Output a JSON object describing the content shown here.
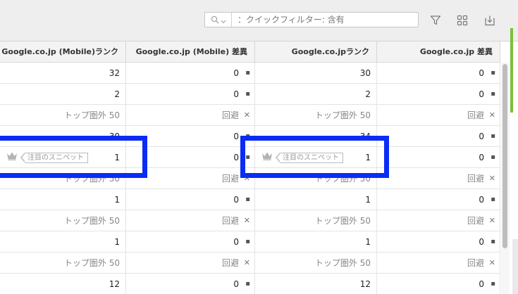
{
  "toolbar": {
    "search_placeholder": "：クイックフィルター: 含有",
    "icons": [
      "search-icon",
      "chevron-down-icon",
      "filter-icon",
      "grid-icon",
      "export-icon"
    ]
  },
  "columns": [
    "Google.co.jp (Mobile)ランク",
    "Google.co.jp (Mobile) 差異",
    "Google.co.jpランク",
    "Google.co.jp 差異"
  ],
  "snippet_label": "注目のスニペット",
  "rows": [
    {
      "r1": "32",
      "d1": "0",
      "m1": "▪",
      "r2": "30",
      "d2": "0",
      "m2": "▪",
      "muted": false,
      "snippet": false
    },
    {
      "r1": "2",
      "d1": "0",
      "m1": "▪",
      "r2": "2",
      "d2": "0",
      "m2": "▪",
      "muted": false,
      "snippet": false
    },
    {
      "r1": "トップ圏外 50",
      "d1": "回避",
      "m1": "✕",
      "r2": "トップ圏外 50",
      "d2": "回避",
      "m2": "✕",
      "muted": true,
      "snippet": false
    },
    {
      "r1": "30",
      "d1": "0",
      "m1": "▪",
      "r2": "34",
      "d2": "0",
      "m2": "▪",
      "muted": false,
      "snippet": false
    },
    {
      "r1": "1",
      "d1": "0",
      "m1": "▪",
      "r2": "1",
      "d2": "0",
      "m2": "▪",
      "muted": false,
      "snippet": true
    },
    {
      "r1": "トップ圏外 50",
      "d1": "回避",
      "m1": "✕",
      "r2": "トップ圏外 50",
      "d2": "回避",
      "m2": "✕",
      "muted": true,
      "snippet": false
    },
    {
      "r1": "1",
      "d1": "0",
      "m1": "▪",
      "r2": "1",
      "d2": "0",
      "m2": "▪",
      "muted": false,
      "snippet": false
    },
    {
      "r1": "トップ圏外 50",
      "d1": "回避",
      "m1": "✕",
      "r2": "トップ圏外 50",
      "d2": "回避",
      "m2": "✕",
      "muted": true,
      "snippet": false
    },
    {
      "r1": "1",
      "d1": "0",
      "m1": "▪",
      "r2": "1",
      "d2": "0",
      "m2": "▪",
      "muted": false,
      "snippet": false
    },
    {
      "r1": "トップ圏外 50",
      "d1": "回避",
      "m1": "✕",
      "r2": "トップ圏外 50",
      "d2": "回避",
      "m2": "✕",
      "muted": true,
      "snippet": false
    },
    {
      "r1": "12",
      "d1": "0",
      "m1": "▪",
      "r2": "12",
      "d2": "0",
      "m2": "▪",
      "muted": false,
      "snippet": false
    }
  ],
  "colors": {
    "highlight": "#0a2cf5",
    "accent_green": "#7cbf3a"
  }
}
